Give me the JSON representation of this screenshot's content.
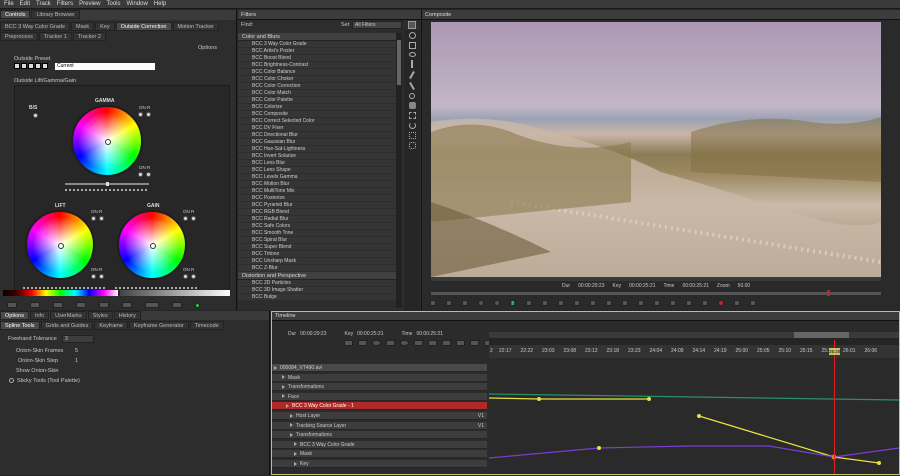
{
  "menu": [
    "File",
    "Edit",
    "Track",
    "Filters",
    "Preview",
    "Tools",
    "Window",
    "Help"
  ],
  "left_panel": {
    "header_tabs": [
      "Controls",
      "Library Browser"
    ],
    "tabs1": [
      "BCC 3 Way Color Grade",
      "Mask",
      "Key",
      "Outside Correction",
      "Motion Tracker"
    ],
    "tabs2": [
      "Preprocess",
      "Tracker 1",
      "Tracker 2"
    ],
    "options": "Options",
    "outside_preset_label": "Outside Preset",
    "preset_value": "Current",
    "section_label": "Outside Lift/Gamma/Gain",
    "bs": "B/S",
    "gamma": "GAMMA",
    "lift": "LIFT",
    "gain": "GAIN",
    "on_r": "ON R"
  },
  "bottom_left": {
    "tabs": [
      "Options",
      "Info",
      "UserMarks",
      "Styles",
      "History"
    ],
    "subtabs": [
      "Spline Tools",
      "Grids and Guides",
      "Keyframe",
      "Keyframe Generator",
      "Timecode"
    ],
    "freehand_label": "Freehand Tolerance",
    "freehand_value": "3",
    "onion_frames_label": "Onion-Skin Frames",
    "onion_frames_value": "5",
    "onion_step_label": "Onion-Skin Step",
    "onion_step_value": "1",
    "show_onion": "Show Onion-Skin",
    "sticky": "Sticky Tools (Tool Palette)"
  },
  "filters": {
    "title": "Filters",
    "find": "Find:",
    "set": "Set",
    "all_filters": "All Filters",
    "cat1": "Color and Blurs",
    "items": [
      "BCC 3 Way Color Grade",
      "BCC Artist's Poster",
      "BCC Boost Blend",
      "BCC Brightness-Contrast",
      "BCC Color Balance",
      "BCC Color Choker",
      "BCC Color Correction",
      "BCC Color Match",
      "BCC Color Palette",
      "BCC Colorize",
      "BCC Composite",
      "BCC Correct Selected Color",
      "BCC DV Fixer",
      "BCC Directional Blur",
      "BCC Gaussian Blur",
      "BCC Hue-Sat-Lightness",
      "BCC Invert Solarize",
      "BCC Lens Blur",
      "BCC Lens Shape",
      "BCC Levels Gamma",
      "BCC Motion Blur",
      "BCC MultiTone Mix",
      "BCC Posterize",
      "BCC Pyramid Blur",
      "BCC RGB Blend",
      "BCC Radial Blur",
      "BCC Safe Colors",
      "BCC Smooth Tone",
      "BCC Spiral Blur",
      "BCC Super Blend",
      "BCC Tritone",
      "BCC Unsharp Mask",
      "BCC Z-Blur"
    ],
    "cat2": "Distortion and Perspective",
    "items2": [
      "BCC 2D Particles",
      "BCC 3D Image Shatter",
      "BCC Bulge"
    ]
  },
  "composite": {
    "title": "Composite",
    "dur_label": "Dur",
    "dur": "00:00:29:23",
    "key_label": "Key",
    "key": "00:00:25:21",
    "time_label": "Time",
    "time": "00:00:25:21",
    "zoom_label": "Zoom",
    "zoom": "50.00"
  },
  "timeline": {
    "title": "Timeline",
    "dur_label": "Dur",
    "dur": "00:00:29:23",
    "key_label": "Key",
    "key": "00:00:25:21",
    "time_label": "Time",
    "time": "00:00:25:21",
    "ruler": [
      "2",
      "22:17",
      "22:22",
      "23:03",
      "23:08",
      "23:13",
      "23:18",
      "23:23",
      "24:04",
      "24:09",
      "24:14",
      "24:19",
      "25:00",
      "25:05",
      "25:10",
      "25:15",
      "25:20",
      "26:01",
      "26:06"
    ],
    "playhead_label": "25:20",
    "tracks": [
      "000084_VT490.avi",
      "Mask",
      "Transformations",
      "Face",
      "BCC 3 Way Color Grade - 1",
      "Host Layer",
      "Tracking Source Layer",
      "Transformations",
      "BCC 3 Way Color Grade",
      "Mask",
      "Key"
    ],
    "vi": "V1"
  },
  "colors": {
    "accent": "#c0272d",
    "selected_track": "#b02a2a",
    "timeline_border": "#c7c26a"
  }
}
